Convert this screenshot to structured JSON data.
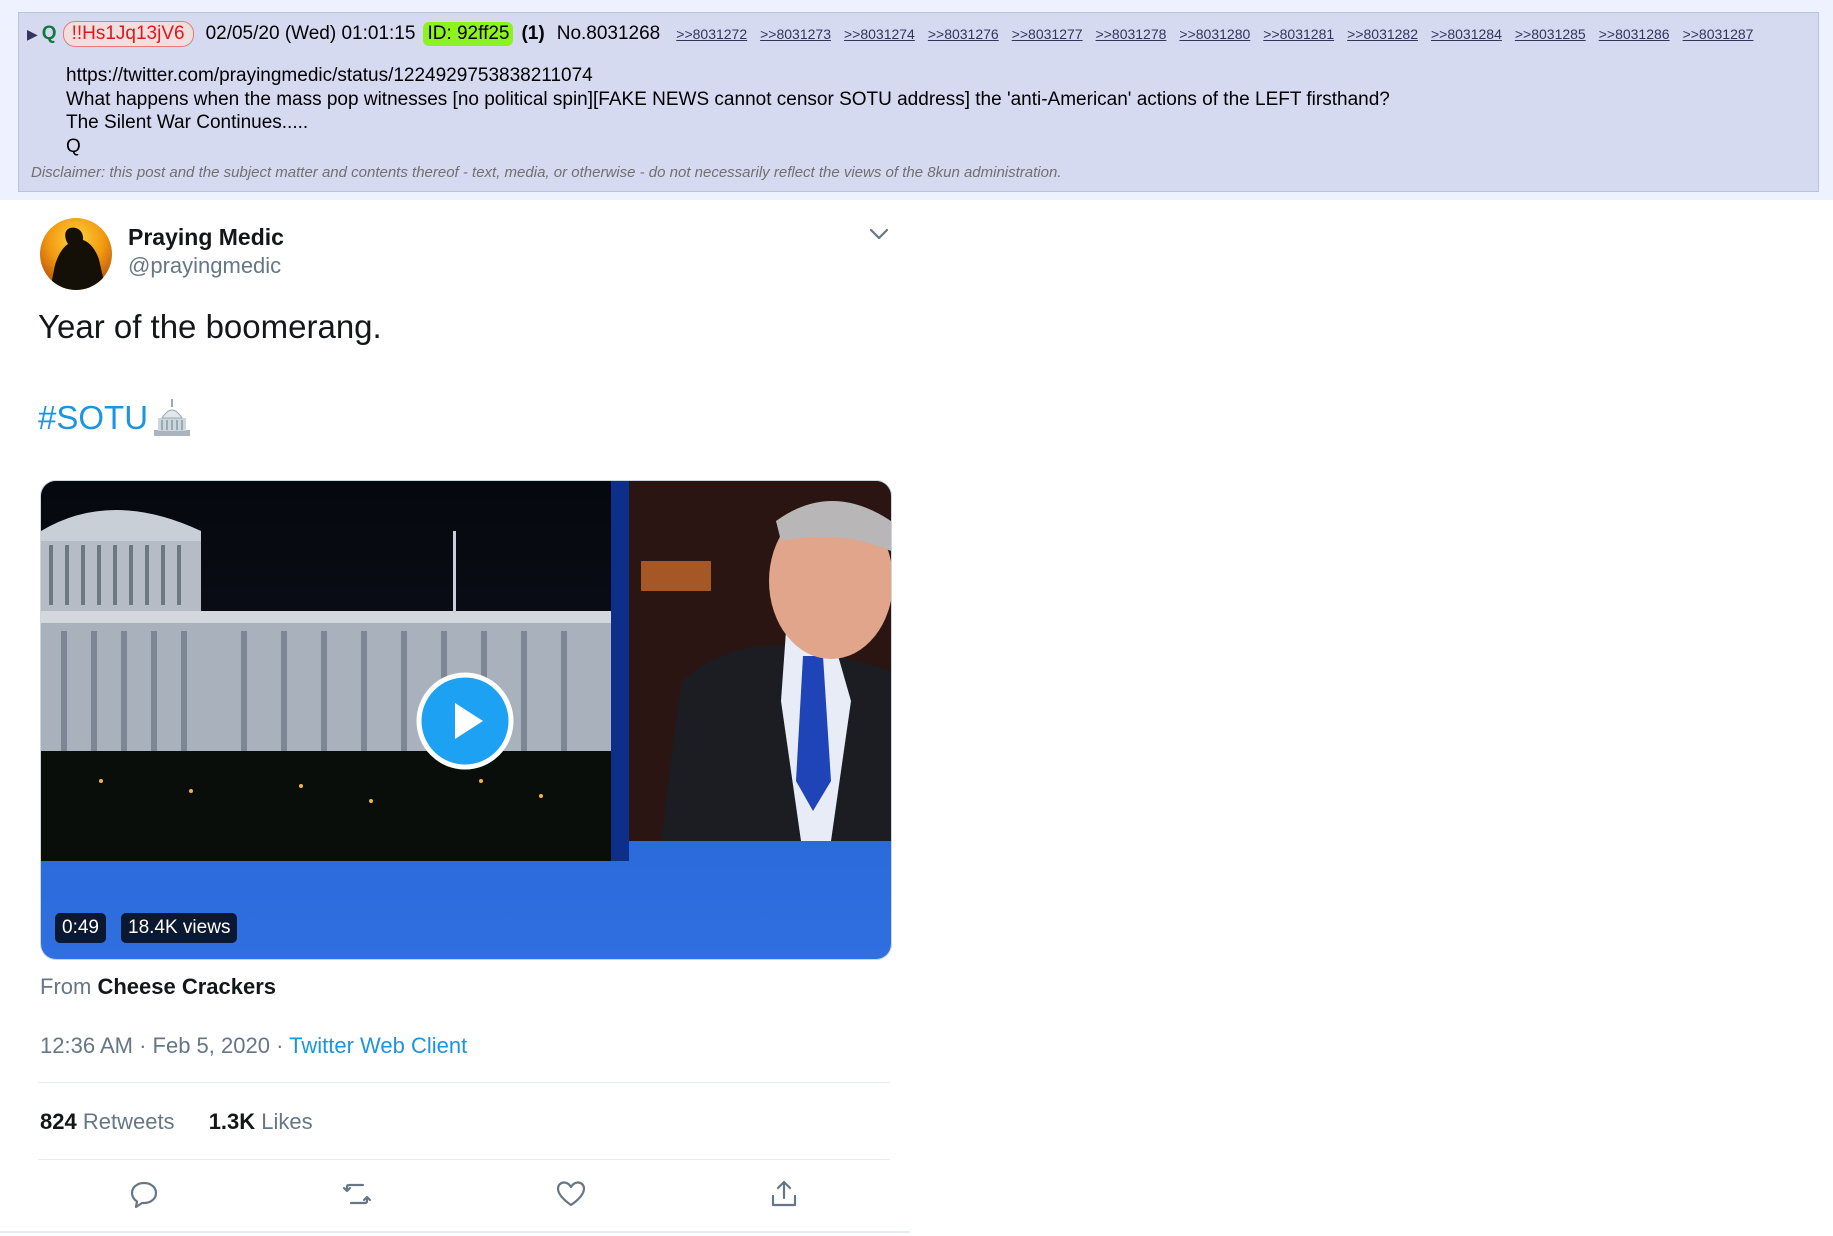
{
  "post": {
    "name": "Q",
    "tripcode": "!!Hs1Jq13jV6",
    "date": "02/05/20 (Wed) 01:01:15",
    "id_badge": "ID: 92ff25",
    "reply_count": "(1)",
    "post_number": "No.8031268",
    "backlinks": [
      ">>8031272",
      ">>8031273",
      ">>8031274",
      ">>8031276",
      ">>8031277",
      ">>8031278",
      ">>8031280",
      ">>8031281",
      ">>8031282",
      ">>8031284",
      ">>8031285",
      ">>8031286",
      ">>8031287"
    ],
    "body": {
      "line1": "https://twitter.com/prayingmedic/status/1224929753838211074",
      "line2": "What happens when the mass pop witnesses [no political spin][FAKE NEWS cannot censor SOTU address] the 'anti-American' actions of the LEFT firsthand?",
      "line3": "The Silent War Continues.....",
      "line4": "Q"
    },
    "disclaimer": "Disclaimer: this post and the subject matter and contents thereof - text, media, or otherwise - do not necessarily reflect the views of the 8kun administration."
  },
  "tweet": {
    "author_name": "Praying Medic",
    "author_handle": "@prayingmedic",
    "text": "Year of the boomerang.",
    "hashtag": "#SOTU",
    "video": {
      "duration": "0:49",
      "views": "18.4K views"
    },
    "source_prefix": "From",
    "source_name": "Cheese Crackers",
    "time": "12:36 AM",
    "date": "Feb 5, 2020",
    "client": "Twitter Web Client",
    "retweets_count": "824",
    "retweets_label": "Retweets",
    "likes_count": "1.3K",
    "likes_label": "Likes",
    "accent_color": "#1b95e0"
  },
  "icons": [
    "expand-triangle-icon",
    "chevron-down-icon",
    "capitol-emoji-icon",
    "play-icon",
    "reply-icon",
    "retweet-icon",
    "like-icon",
    "share-icon"
  ]
}
